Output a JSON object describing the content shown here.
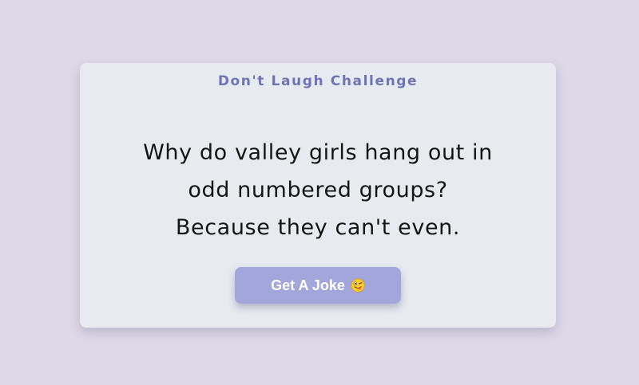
{
  "card": {
    "title": "Don't Laugh Challenge",
    "joke_lines": [
      "Why do valley girls hang out in",
      "odd numbered groups?",
      "Because they can't even."
    ]
  },
  "button": {
    "label": "Get A Joke",
    "icon": "winking-tongue-face-emoji"
  },
  "colors": {
    "background": "#ded9e8",
    "card": "#e7ebf0",
    "title": "#6f74b4",
    "button": "#a3a6da"
  }
}
